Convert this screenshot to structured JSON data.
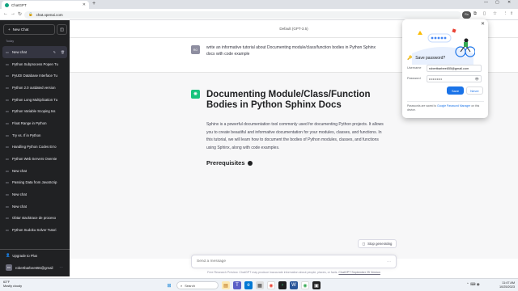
{
  "browser": {
    "tab_title": "ChatGPT",
    "url": "chat.openai.com",
    "profile_initials": "Rn"
  },
  "sidebar": {
    "new_chat_label": "New Chat",
    "section_today": "Today",
    "items": [
      {
        "label": "New chat",
        "active": true
      },
      {
        "label": "Python Subprocess Popen Tu"
      },
      {
        "label": "PyUDI Database Interface Tu"
      },
      {
        "label": "Python 2.0 outdated version"
      },
      {
        "label": "Python Long Multiplication Tu"
      },
      {
        "label": "Python Variable Scoping Iss"
      },
      {
        "label": "Float Range in Python"
      },
      {
        "label": "Try vs. If in Python"
      },
      {
        "label": "Handling Python Codes Erro"
      },
      {
        "label": "Python Web Servers Overvie"
      },
      {
        "label": "New chat"
      },
      {
        "label": "Passing Data from JavaScrip"
      },
      {
        "label": "New chat"
      },
      {
        "label": "New chat"
      },
      {
        "label": "Obtar stacktrace de proceso"
      },
      {
        "label": "Python Sudoku Solver Tutori"
      }
    ],
    "upgrade_label": "Upgrade to Plus",
    "user_email": "robertbarbee655@gmail",
    "user_initials": "RO"
  },
  "main": {
    "model_label": "Default (GPT-3.5)",
    "user_initials": "RO",
    "user_message": "write an informative tutorial about Documenting module/class/function bodies in Python Sphinx docs with code example",
    "heading": "Documenting Module/Class/Function Bodies in Python Sphinx Docs",
    "paragraph": "Sphinx is a powerful documentation tool commonly used for documenting Python projects. It allows you to create beautiful and informative documentation for your modules, classes, and functions. In this tutorial, we will learn how to document the bodies of Python modules, classes, and functions using Sphinx, along with code examples.",
    "subheading": "Prerequisites",
    "stop_label": "Stop generating",
    "composer_placeholder": "Send a message",
    "footer_text": "Free Research Preview. ChatGPT may produce inaccurate information about people, places, or facts.",
    "footer_link": "ChatGPT September 25 Version"
  },
  "password_popup": {
    "title": "Save password?",
    "username_label": "Username",
    "username_value": "robertbarbee655@gmail.com",
    "password_label": "Password",
    "password_value": "••••••••••",
    "save_label": "Save",
    "never_label": "Never",
    "note_prefix": "Passwords are saved to",
    "note_link": "Google Password Manager",
    "note_suffix": "on this device."
  },
  "taskbar": {
    "weather_temp": "63°F",
    "weather_desc": "Mostly cloudy",
    "search_label": "Search",
    "time": "11:47 AM",
    "date": "10/25/2023"
  },
  "colors": {
    "sidebar_bg": "#202123",
    "gpt_green": "#19c37d",
    "accent_blue": "#1a73e8"
  }
}
